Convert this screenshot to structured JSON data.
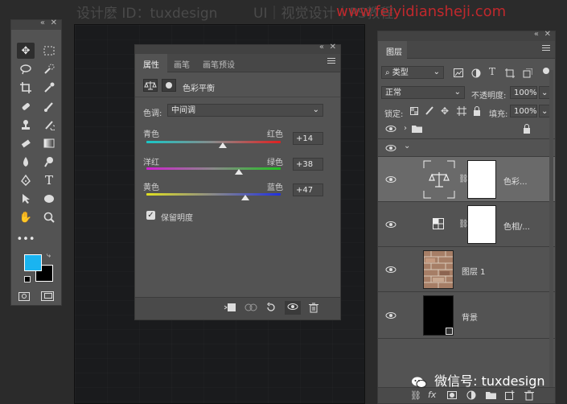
{
  "watermark": {
    "left": "设计麽 ID：tuxdesign",
    "mid": "UI｜视觉设计｜PS教程",
    "site": "www.feiyidiansheji.com"
  },
  "tools_panel": {
    "collapse": "«",
    "close": "✕"
  },
  "properties": {
    "collapse": "«",
    "close": "✕",
    "tabs": [
      "属性",
      "画笔",
      "画笔预设"
    ],
    "adjustment_title": "色彩平衡",
    "tone_label": "色调:",
    "tone_value": "中间调",
    "sliders": [
      {
        "left": "青色",
        "right": "红色",
        "value": "+14",
        "level": 14
      },
      {
        "left": "洋红",
        "right": "绿色",
        "value": "+38",
        "level": 38
      },
      {
        "left": "黄色",
        "right": "蓝色",
        "value": "+47",
        "level": 47
      }
    ],
    "preserve_luminosity": "保留明度"
  },
  "layers": {
    "collapse": "«",
    "close": "✕",
    "tab": "图层",
    "filter_label": "类型",
    "blend_mode": "正常",
    "opacity_label": "不透明度:",
    "opacity_value": "100%",
    "lock_label": "锁定:",
    "fill_label": "填充:",
    "fill_value": "100%",
    "items": [
      {
        "name": "色彩..."
      },
      {
        "name": "色相/..."
      },
      {
        "name": "图层 1"
      },
      {
        "name": "背景"
      }
    ],
    "footer": {
      "fx": "fx"
    }
  },
  "wechat": "微信号: tuxdesign",
  "colors": {
    "foreground": "#1ab4f0",
    "background": "#000000"
  }
}
